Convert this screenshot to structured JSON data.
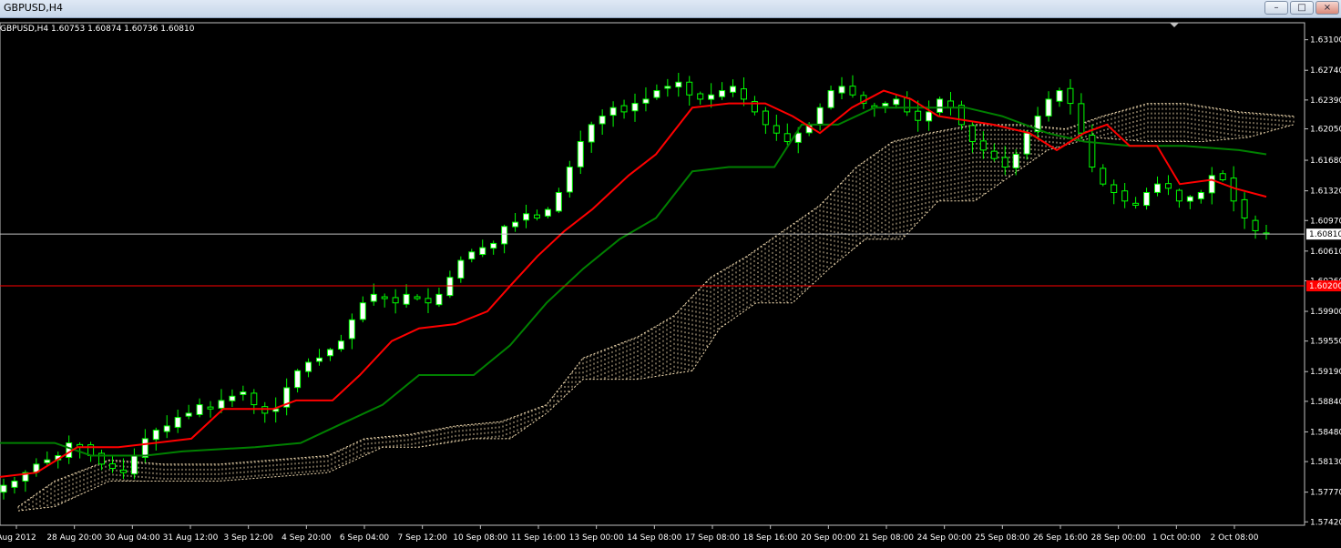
{
  "window": {
    "title": "GBPUSD,H4",
    "minimize_icon": "minimize-icon",
    "restore_icon": "restore-icon",
    "close_icon": "close-icon"
  },
  "info_line": "GBPUSD,H4  1.60753 1.60874 1.60736 1.60810",
  "chart_data": {
    "type": "candlestick",
    "symbol": "GBPUSD",
    "timeframe": "H4",
    "ohlc_header": {
      "open": 1.60753,
      "high": 1.60874,
      "low": 1.60736,
      "close": 1.6081
    },
    "y_ticks": [
      "1.63100",
      "1.62740",
      "1.62390",
      "1.62050",
      "1.61680",
      "1.61320",
      "1.60970",
      "1.60610",
      "1.60260",
      "1.59900",
      "1.59550",
      "1.59190",
      "1.58840",
      "1.58480",
      "1.58130",
      "1.57770",
      "1.57420"
    ],
    "ylim": [
      1.5738,
      1.633
    ],
    "x_ticks": [
      "Aug 2012",
      "28 Aug 20:00",
      "30 Aug 04:00",
      "31 Aug 12:00",
      "3 Sep 12:00",
      "4 Sep 20:00",
      "6 Sep 04:00",
      "7 Sep 12:00",
      "10 Sep 08:00",
      "11 Sep 16:00",
      "13 Sep 00:00",
      "14 Sep 08:00",
      "17 Sep 08:00",
      "18 Sep 16:00",
      "20 Sep 00:00",
      "21 Sep 08:00",
      "24 Sep 00:00",
      "25 Sep 08:00",
      "26 Sep 16:00",
      "28 Sep 00:00",
      "1 Oct 00:00",
      "2 Oct 08:00"
    ],
    "current_price": {
      "label": "1.60810",
      "value": 1.6081,
      "color": "#ffffff"
    },
    "horizontal_line": {
      "label": "1.60200",
      "value": 1.602,
      "color": "#ff0000"
    },
    "colors": {
      "background": "#000000",
      "bull_candle": "#ffffff",
      "bear_candle": "#000000",
      "wick": "#00ff00",
      "tenkan": "#ff0000",
      "kijun": "#008000",
      "cloud": "#f5deb3"
    },
    "close_path": [
      1.5785,
      1.579,
      1.58,
      1.581,
      1.5815,
      1.582,
      1.5835,
      1.583,
      1.582,
      1.581,
      1.5805,
      1.58,
      1.582,
      1.584,
      1.585,
      1.5855,
      1.5865,
      1.587,
      1.588,
      1.5875,
      1.5885,
      1.589,
      1.5895,
      1.588,
      1.587,
      1.5875,
      1.59,
      1.592,
      1.593,
      1.5935,
      1.5945,
      1.5955,
      1.598,
      1.6,
      1.601,
      1.6005,
      1.6,
      1.601,
      1.6005,
      1.6,
      1.601,
      1.603,
      1.605,
      1.606,
      1.6065,
      1.607,
      1.609,
      1.6095,
      1.6105,
      1.61,
      1.611,
      1.613,
      1.616,
      1.619,
      1.621,
      1.622,
      1.623,
      1.6225,
      1.6235,
      1.624,
      1.625,
      1.6255,
      1.626,
      1.6245,
      1.624,
      1.6245,
      1.625,
      1.6255,
      1.624,
      1.6225,
      1.621,
      1.62,
      1.619,
      1.62,
      1.621,
      1.623,
      1.625,
      1.6255,
      1.6245,
      1.6235,
      1.623,
      1.6235,
      1.624,
      1.6225,
      1.6215,
      1.6225,
      1.624,
      1.623,
      1.621,
      1.619,
      1.618,
      1.617,
      1.616,
      1.6175,
      1.62,
      1.622,
      1.624,
      1.625,
      1.6235,
      1.62,
      1.616,
      1.614,
      1.613,
      1.612,
      1.6115,
      1.613,
      1.614,
      1.6135,
      1.612,
      1.6125,
      1.613,
      1.615,
      1.6145,
      1.612,
      1.61,
      1.6085,
      1.6081
    ],
    "tenkan_sen": [
      [
        0,
        1.5795
      ],
      [
        40,
        1.58
      ],
      [
        85,
        1.583
      ],
      [
        130,
        1.583
      ],
      [
        170,
        1.5835
      ],
      [
        210,
        1.584
      ],
      [
        245,
        1.5875
      ],
      [
        300,
        1.5875
      ],
      [
        325,
        1.5885
      ],
      [
        365,
        1.5885
      ],
      [
        395,
        1.5915
      ],
      [
        430,
        1.5955
      ],
      [
        460,
        1.597
      ],
      [
        500,
        1.5975
      ],
      [
        535,
        1.599
      ],
      [
        560,
        1.602
      ],
      [
        590,
        1.6055
      ],
      [
        620,
        1.6085
      ],
      [
        650,
        1.611
      ],
      [
        690,
        1.615
      ],
      [
        720,
        1.6175
      ],
      [
        760,
        1.623
      ],
      [
        800,
        1.6235
      ],
      [
        840,
        1.6235
      ],
      [
        870,
        1.622
      ],
      [
        900,
        1.62
      ],
      [
        935,
        1.623
      ],
      [
        970,
        1.625
      ],
      [
        1000,
        1.624
      ],
      [
        1030,
        1.622
      ],
      [
        1060,
        1.6215
      ],
      [
        1090,
        1.621
      ],
      [
        1130,
        1.62
      ],
      [
        1160,
        1.618
      ],
      [
        1190,
        1.62
      ],
      [
        1215,
        1.621
      ],
      [
        1240,
        1.6185
      ],
      [
        1270,
        1.6185
      ],
      [
        1295,
        1.614
      ],
      [
        1330,
        1.6145
      ],
      [
        1355,
        1.6135
      ],
      [
        1390,
        1.6125
      ]
    ],
    "kijun_sen": [
      [
        0,
        1.5835
      ],
      [
        60,
        1.5835
      ],
      [
        100,
        1.582
      ],
      [
        160,
        1.582
      ],
      [
        200,
        1.5825
      ],
      [
        280,
        1.583
      ],
      [
        330,
        1.5835
      ],
      [
        380,
        1.586
      ],
      [
        420,
        1.588
      ],
      [
        460,
        1.5915
      ],
      [
        520,
        1.5915
      ],
      [
        560,
        1.595
      ],
      [
        600,
        1.6
      ],
      [
        640,
        1.604
      ],
      [
        680,
        1.6075
      ],
      [
        720,
        1.61
      ],
      [
        760,
        1.6155
      ],
      [
        800,
        1.616
      ],
      [
        850,
        1.616
      ],
      [
        880,
        1.621
      ],
      [
        920,
        1.621
      ],
      [
        960,
        1.623
      ],
      [
        1010,
        1.623
      ],
      [
        1060,
        1.623
      ],
      [
        1100,
        1.622
      ],
      [
        1150,
        1.62
      ],
      [
        1190,
        1.619
      ],
      [
        1240,
        1.6185
      ],
      [
        1300,
        1.6185
      ],
      [
        1360,
        1.618
      ],
      [
        1390,
        1.6175
      ]
    ],
    "senkou_a": [
      [
        20,
        1.576
      ],
      [
        60,
        1.579
      ],
      [
        120,
        1.5815
      ],
      [
        180,
        1.581
      ],
      [
        240,
        1.581
      ],
      [
        300,
        1.5815
      ],
      [
        360,
        1.582
      ],
      [
        400,
        1.584
      ],
      [
        450,
        1.5845
      ],
      [
        500,
        1.5855
      ],
      [
        550,
        1.586
      ],
      [
        600,
        1.588
      ],
      [
        640,
        1.5935
      ],
      [
        700,
        1.596
      ],
      [
        740,
        1.5985
      ],
      [
        780,
        1.603
      ],
      [
        820,
        1.6055
      ],
      [
        860,
        1.6085
      ],
      [
        900,
        1.6115
      ],
      [
        940,
        1.616
      ],
      [
        980,
        1.619
      ],
      [
        1020,
        1.62
      ],
      [
        1070,
        1.621
      ],
      [
        1120,
        1.621
      ],
      [
        1170,
        1.6205
      ],
      [
        1210,
        1.622
      ],
      [
        1260,
        1.6235
      ],
      [
        1300,
        1.6235
      ],
      [
        1360,
        1.6225
      ],
      [
        1420,
        1.622
      ]
    ],
    "senkou_b": [
      [
        20,
        1.5755
      ],
      [
        60,
        1.576
      ],
      [
        120,
        1.579
      ],
      [
        180,
        1.579
      ],
      [
        240,
        1.579
      ],
      [
        300,
        1.5795
      ],
      [
        360,
        1.58
      ],
      [
        420,
        1.583
      ],
      [
        460,
        1.583
      ],
      [
        520,
        1.584
      ],
      [
        560,
        1.584
      ],
      [
        600,
        1.587
      ],
      [
        640,
        1.591
      ],
      [
        700,
        1.591
      ],
      [
        760,
        1.592
      ],
      [
        790,
        1.597
      ],
      [
        830,
        1.6
      ],
      [
        870,
        1.6
      ],
      [
        910,
        1.604
      ],
      [
        950,
        1.6075
      ],
      [
        990,
        1.6075
      ],
      [
        1030,
        1.612
      ],
      [
        1070,
        1.612
      ],
      [
        1110,
        1.615
      ],
      [
        1150,
        1.618
      ],
      [
        1200,
        1.6195
      ],
      [
        1260,
        1.619
      ],
      [
        1320,
        1.619
      ],
      [
        1370,
        1.6195
      ],
      [
        1420,
        1.621
      ]
    ]
  }
}
